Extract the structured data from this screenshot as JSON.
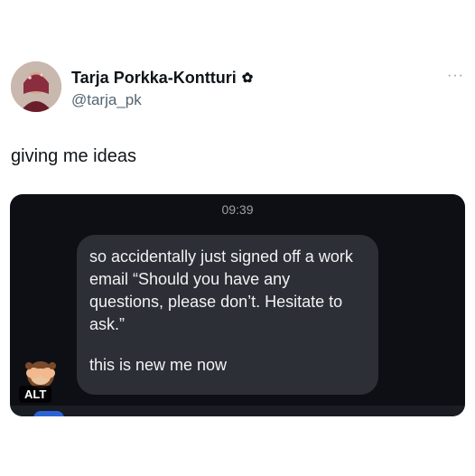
{
  "author": {
    "display_name": "Tarja Porkka-Kontturi",
    "handle": "@tarja_pk",
    "badge_icon": "flower-icon"
  },
  "post": {
    "text": "giving me ideas"
  },
  "media": {
    "time": "09:39",
    "message_part1": "so accidentally just signed off a work email “Should you have any questions, please don’t. Hesitate to ask.”",
    "message_part2": "this is new me now",
    "alt_label": "ALT",
    "reaction_icon": "see-no-evil-monkey-icon"
  },
  "more_icon": "more-horizontal-icon"
}
